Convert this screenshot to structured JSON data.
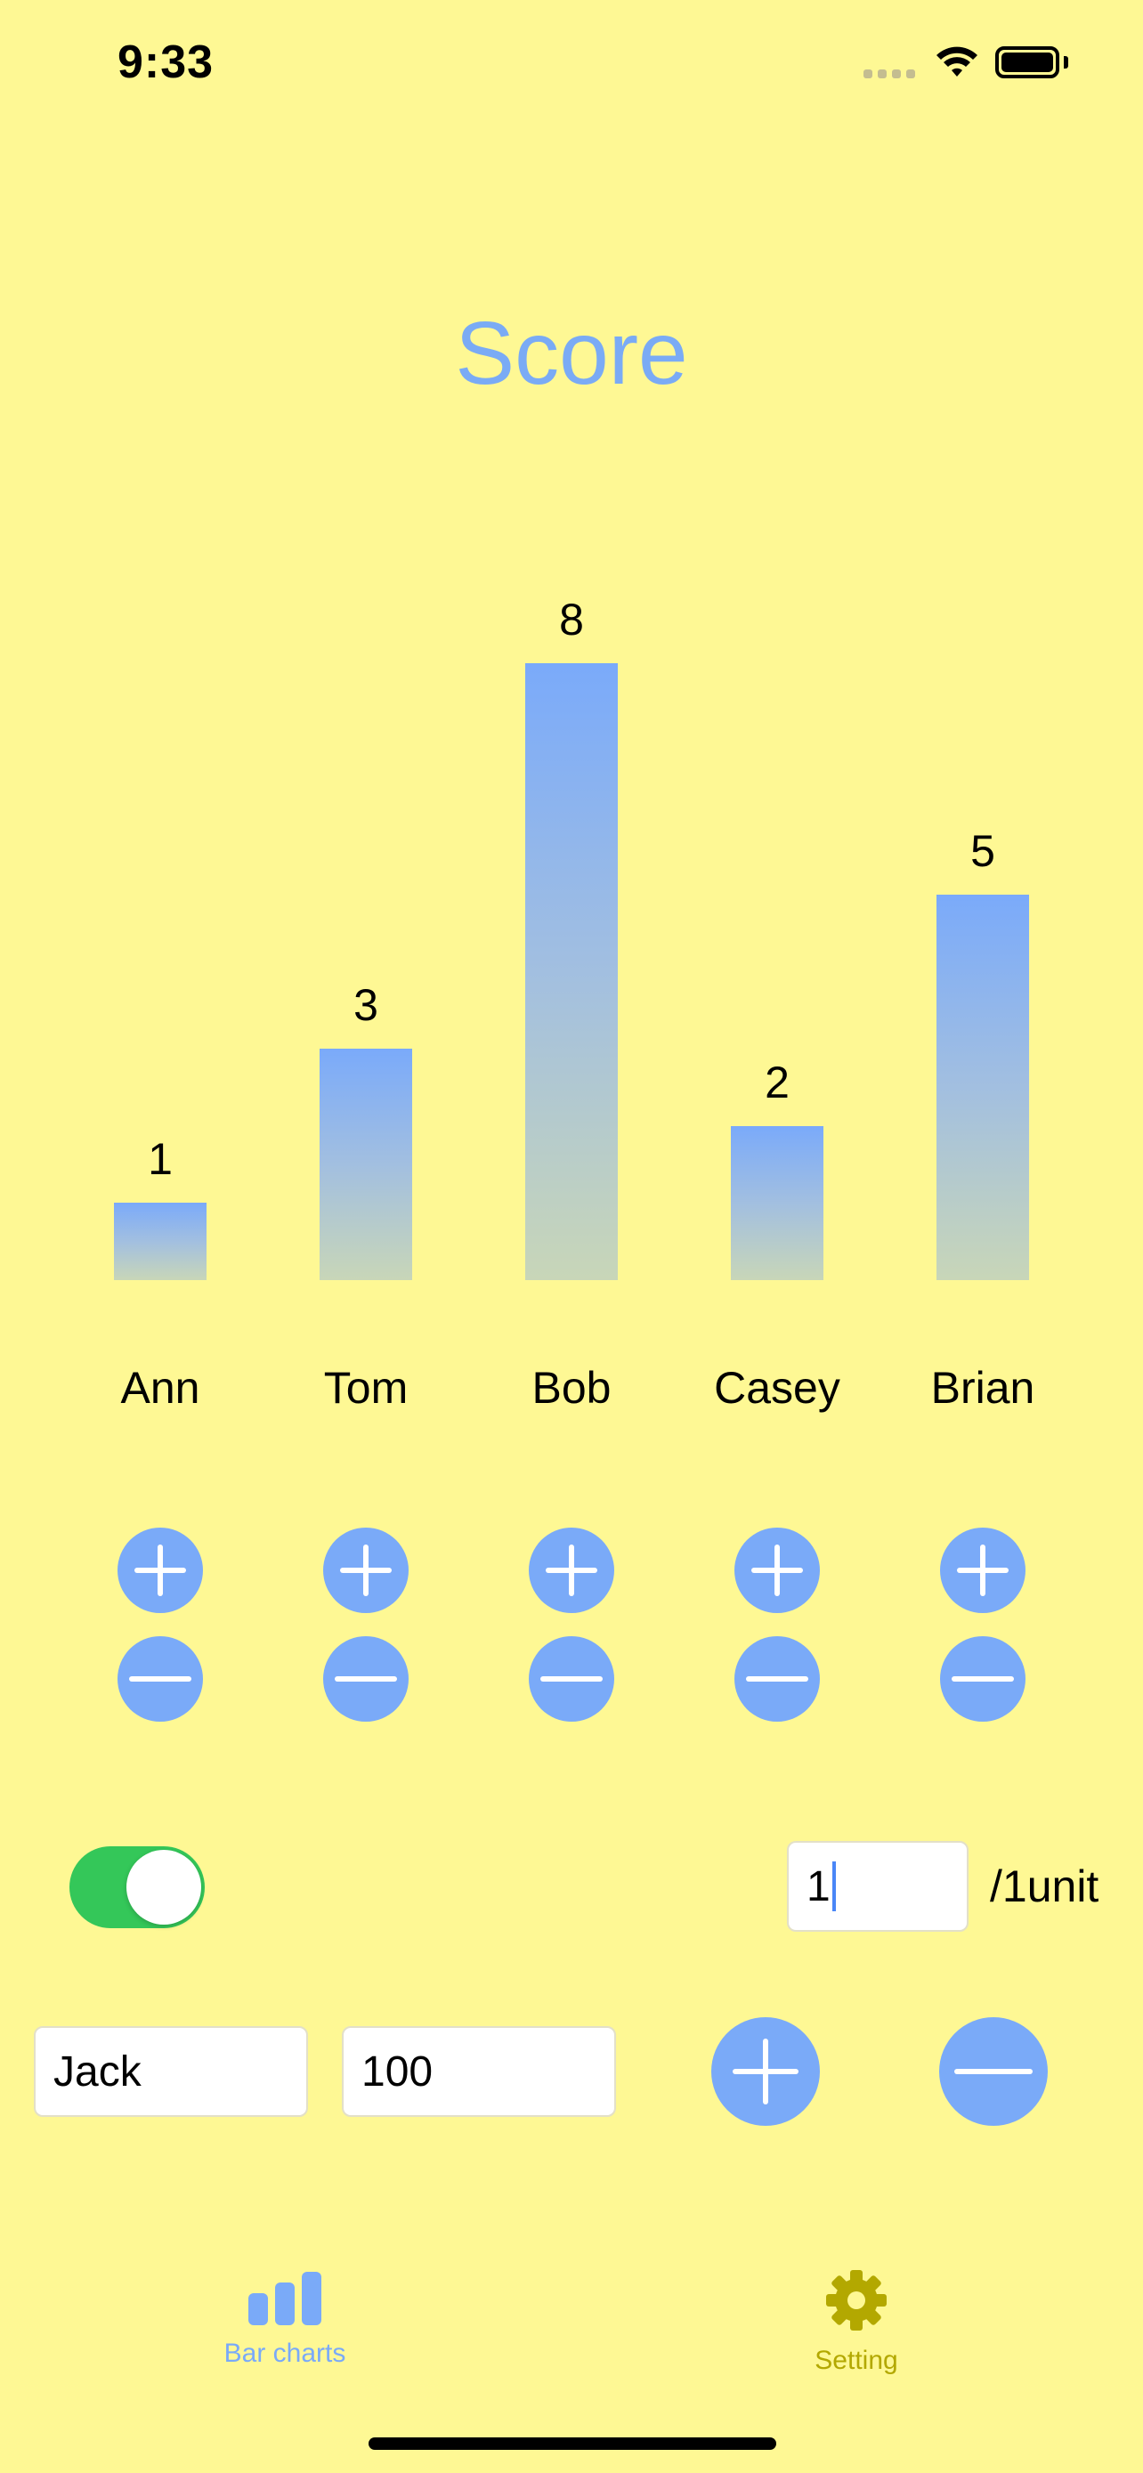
{
  "status_bar": {
    "time": "9:33"
  },
  "header": {
    "title": "Score"
  },
  "chart_data": {
    "type": "bar",
    "categories": [
      "Ann",
      "Tom",
      "Bob",
      "Casey",
      "Brian"
    ],
    "values": [
      1,
      3,
      8,
      2,
      5
    ],
    "title": "Score",
    "xlabel": "",
    "ylabel": "",
    "ylim": [
      0,
      8
    ],
    "grid": false,
    "colors": {
      "bar_top": "#7AAAFA",
      "bar_bottom": "#C8D6B8"
    }
  },
  "controls": {
    "increment_icon": "plus-icon",
    "decrement_icon": "minus-icon",
    "button_color": "#7AAAF8"
  },
  "settings_row": {
    "toggle_on": true,
    "step_value": "1",
    "unit_label": "/1unit"
  },
  "add_row": {
    "name_value": "Jack",
    "score_value": "100"
  },
  "tab_bar": {
    "tabs": [
      {
        "label": "Bar charts",
        "icon": "bar-chart-icon",
        "active": true,
        "color": "#7AAAF8"
      },
      {
        "label": "Setting",
        "icon": "gear-icon",
        "active": false,
        "color": "#B3A800"
      }
    ]
  },
  "colors": {
    "background": "#FEF894",
    "accent": "#7AABF5",
    "toggle": "#34C759"
  }
}
